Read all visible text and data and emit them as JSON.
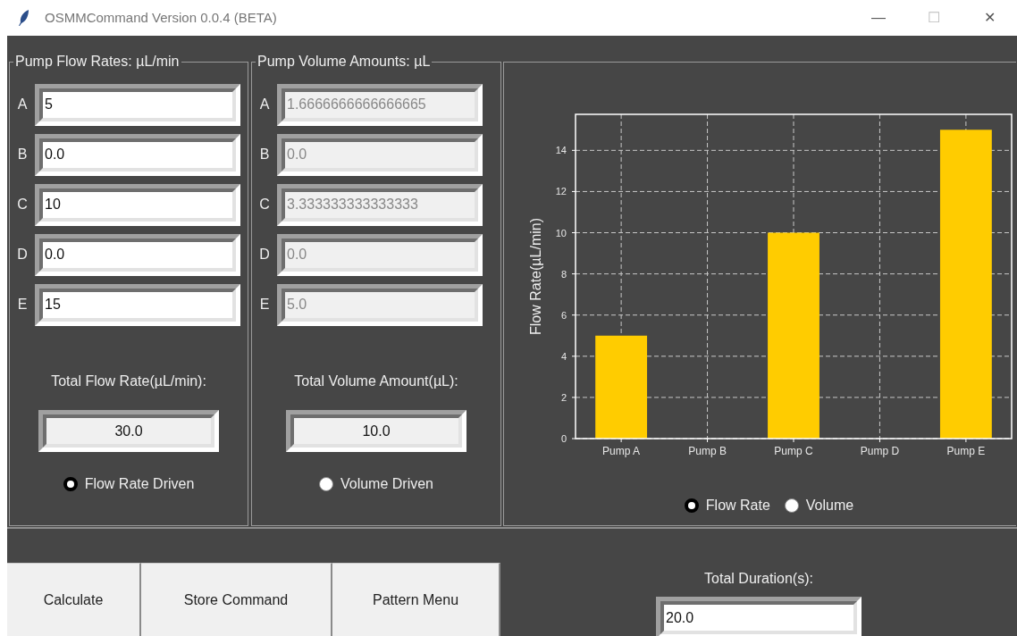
{
  "window": {
    "title": "OSMMCommand Version 0.0.4 (BETA)",
    "controls": [
      "—",
      "☐",
      "✕"
    ]
  },
  "flow_panel": {
    "title": "Pump Flow Rates: µL/min",
    "pumps": [
      {
        "label": "A",
        "value": "5",
        "disabled": false
      },
      {
        "label": "B",
        "value": "0.0",
        "disabled": false
      },
      {
        "label": "C",
        "value": "10",
        "disabled": false
      },
      {
        "label": "D",
        "value": "0.0",
        "disabled": false
      },
      {
        "label": "E",
        "value": "15",
        "disabled": false
      }
    ],
    "total_label": "Total Flow Rate(µL/min):",
    "total_value": "30.0",
    "mode": {
      "label": "Flow Rate Driven",
      "selected": true
    }
  },
  "volume_panel": {
    "title": "Pump Volume Amounts: µL",
    "pumps": [
      {
        "label": "A",
        "value": "1.6666666666666665",
        "disabled": true
      },
      {
        "label": "B",
        "value": "0.0",
        "disabled": true
      },
      {
        "label": "C",
        "value": "3.333333333333333",
        "disabled": true
      },
      {
        "label": "D",
        "value": "0.0",
        "disabled": true
      },
      {
        "label": "E",
        "value": "5.0",
        "disabled": true
      }
    ],
    "total_label": "Total Volume Amount(µL):",
    "total_value": "10.0",
    "mode": {
      "label": "Volume Driven",
      "selected": false
    }
  },
  "chart_panel": {
    "chart_data": {
      "type": "bar",
      "ylabel": "Flow Rate(µL/min)",
      "categories": [
        "Pump A",
        "Pump B",
        "Pump C",
        "Pump D",
        "Pump E"
      ],
      "series": [
        {
          "color": "#ffcc00",
          "values": [
            5,
            0,
            10,
            0,
            15
          ]
        }
      ],
      "ylim": [
        0,
        15.75
      ],
      "grid": true,
      "yticks": [
        0,
        2,
        4,
        6,
        8,
        10,
        12,
        14
      ]
    },
    "views": [
      {
        "label": "Flow Rate",
        "selected": true
      },
      {
        "label": "Volume",
        "selected": false
      }
    ]
  },
  "buttons": [
    "Calculate",
    "Store Command",
    "Pattern Menu"
  ],
  "duration": {
    "label": "Total Duration(s):",
    "value": "20.0"
  }
}
